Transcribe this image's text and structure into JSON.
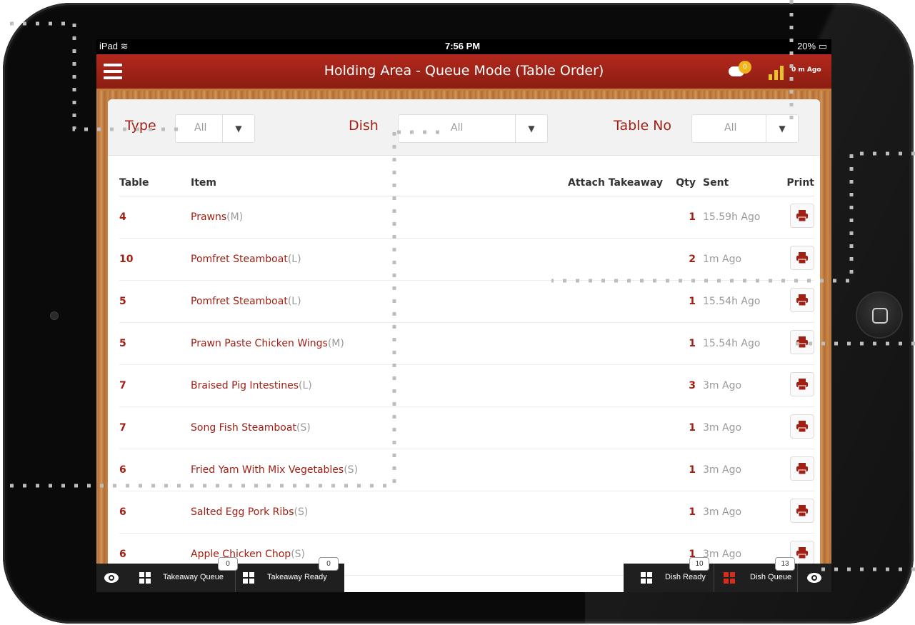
{
  "status": {
    "carrier": "iPad",
    "time": "7:56 PM",
    "battery": "20%"
  },
  "header": {
    "title": "Holding Area - Queue Mode (Table Order)",
    "notification_count": "0",
    "last_update": "0 m Ago"
  },
  "filters": {
    "type_label": "Type",
    "type_value": "All",
    "dish_label": "Dish",
    "dish_value": "All",
    "table_label": "Table No",
    "table_value": "All"
  },
  "columns": {
    "table": "Table",
    "item": "Item",
    "attach": "Attach Takeaway",
    "qty": "Qty",
    "sent": "Sent",
    "print": "Print"
  },
  "rows": [
    {
      "table": "4",
      "item": "Prawns",
      "size": "(M)",
      "qty": "1",
      "sent": "15.59h Ago"
    },
    {
      "table": "10",
      "item": "Pomfret Steamboat",
      "size": "(L)",
      "qty": "2",
      "sent": "1m Ago"
    },
    {
      "table": "5",
      "item": "Pomfret Steamboat",
      "size": "(L)",
      "qty": "1",
      "sent": "15.54h Ago"
    },
    {
      "table": "5",
      "item": "Prawn Paste Chicken Wings",
      "size": "(M)",
      "qty": "1",
      "sent": "15.54h Ago"
    },
    {
      "table": "7",
      "item": "Braised Pig Intestines",
      "size": "(L)",
      "qty": "3",
      "sent": "3m Ago"
    },
    {
      "table": "7",
      "item": "Song Fish Steamboat",
      "size": "(S)",
      "qty": "1",
      "sent": "3m Ago"
    },
    {
      "table": "6",
      "item": "Fried Yam With Mix Vegetables",
      "size": "(S)",
      "qty": "1",
      "sent": "3m Ago"
    },
    {
      "table": "6",
      "item": "Salted Egg Pork Ribs",
      "size": "(S)",
      "qty": "1",
      "sent": "3m Ago"
    },
    {
      "table": "6",
      "item": "Apple Chicken Chop",
      "size": "(S)",
      "qty": "1",
      "sent": "3m Ago"
    }
  ],
  "bottom": {
    "takeaway_queue": {
      "label": "Takeaway Queue",
      "count": "0"
    },
    "takeaway_ready": {
      "label": "Takeaway Ready",
      "count": "0"
    },
    "dish_ready": {
      "label": "Dish Ready",
      "count": "10"
    },
    "dish_queue": {
      "label": "Dish Queue",
      "count": "13"
    }
  },
  "colors": {
    "accent": "#a21f14",
    "header": "#a8261a",
    "badge": "#f0b51a"
  },
  "icons": [
    "menu-icon",
    "chat-icon",
    "signal-icon",
    "dropdown-arrow-icon",
    "printer-icon",
    "eye-icon",
    "grid-icon",
    "home-button-icon"
  ]
}
